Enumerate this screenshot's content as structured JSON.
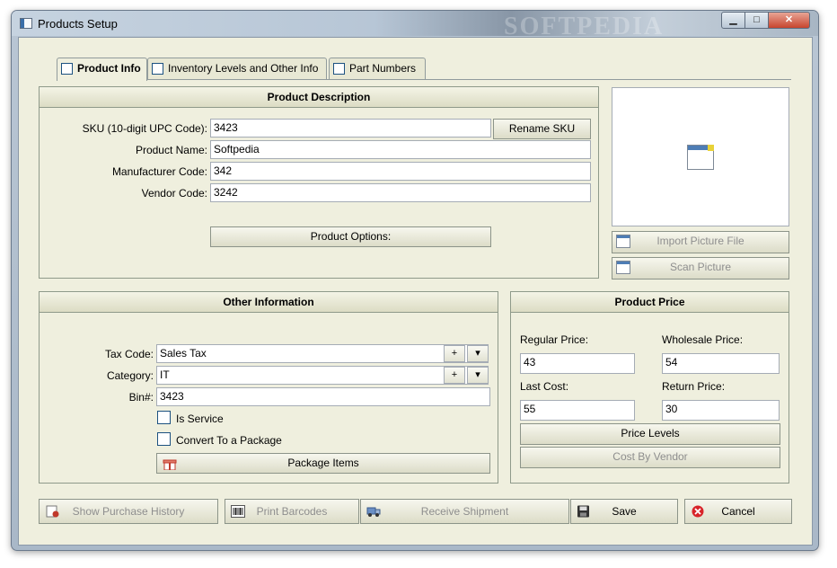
{
  "window": {
    "title": "Products Setup",
    "watermark": "SOFTPEDIA",
    "min_glyph": "▁",
    "max_glyph": "□",
    "close_glyph": "✕"
  },
  "tabs": [
    {
      "label": "Product Info",
      "active": true
    },
    {
      "label": "Inventory Levels and Other Info",
      "active": false
    },
    {
      "label": "Part Numbers",
      "active": false
    }
  ],
  "product_description": {
    "heading": "Product Description",
    "sku_label": "SKU (10-digit UPC Code):",
    "sku_value": "3423",
    "rename_sku": "Rename SKU",
    "name_label": "Product Name:",
    "name_value": "Softpedia",
    "mfr_label": "Manufacturer Code:",
    "mfr_value": "342",
    "vendor_label": "Vendor Code:",
    "vendor_value": "3242",
    "options_button": "Product Options:"
  },
  "picture": {
    "import_button": "Import Picture File",
    "scan_button": "Scan Picture"
  },
  "other_info": {
    "heading": "Other Information",
    "tax_label": "Tax Code:",
    "tax_value": "Sales Tax",
    "category_label": "Category:",
    "category_value": "IT",
    "bin_label": "Bin#:",
    "bin_value": "3423",
    "is_service_label": "Is Service",
    "is_service_checked": false,
    "convert_label": "Convert To a Package",
    "convert_checked": false,
    "package_items": "Package Items",
    "plus_glyph": "+",
    "dropdown_glyph": "▾"
  },
  "price": {
    "heading": "Product Price",
    "regular_label": "Regular Price:",
    "regular_value": "43",
    "wholesale_label": "Wholesale Price:",
    "wholesale_value": "54",
    "last_cost_label": "Last Cost:",
    "last_cost_value": "55",
    "return_label": "Return Price:",
    "return_value": "30",
    "price_levels": "Price Levels",
    "cost_by_vendor": "Cost By Vendor"
  },
  "footer": {
    "purchase_history": "Show Purchase History",
    "print_barcodes": "Print Barcodes",
    "receive_shipment": "Receive Shipment",
    "save": "Save",
    "cancel": "Cancel"
  },
  "colors": {
    "client_bg": "#efefde",
    "cancel_icon": "#d8242a"
  }
}
